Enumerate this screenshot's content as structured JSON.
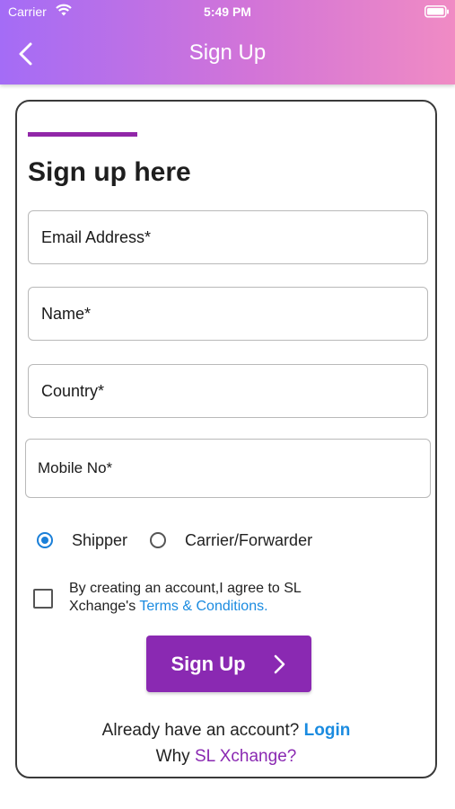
{
  "status_bar": {
    "carrier": "Carrier",
    "time": "5:49 PM"
  },
  "nav": {
    "title": "Sign Up",
    "back_icon": "chevron-left-icon"
  },
  "form": {
    "heading": "Sign up here",
    "fields": {
      "email": "Email Address*",
      "name": "Name*",
      "country": "Country*",
      "mobile": "Mobile No*"
    },
    "role_options": [
      {
        "label": "Shipper",
        "selected": true
      },
      {
        "label": "Carrier/Forwarder",
        "selected": false
      }
    ],
    "terms_text": "By creating an account,I agree to SL Xchange's",
    "terms_link": "Terms & Conditions.",
    "terms_checked": false,
    "submit_label": "Sign Up",
    "already_text": "Already have an account?",
    "login_link": "Login",
    "why_text": "Why",
    "why_link": "SL Xchange?"
  },
  "colors": {
    "accent": "#9127a8",
    "button": "#8a29b2",
    "link": "#1a8be0",
    "header_start": "#a46cf6",
    "header_end": "#f08bc4"
  }
}
